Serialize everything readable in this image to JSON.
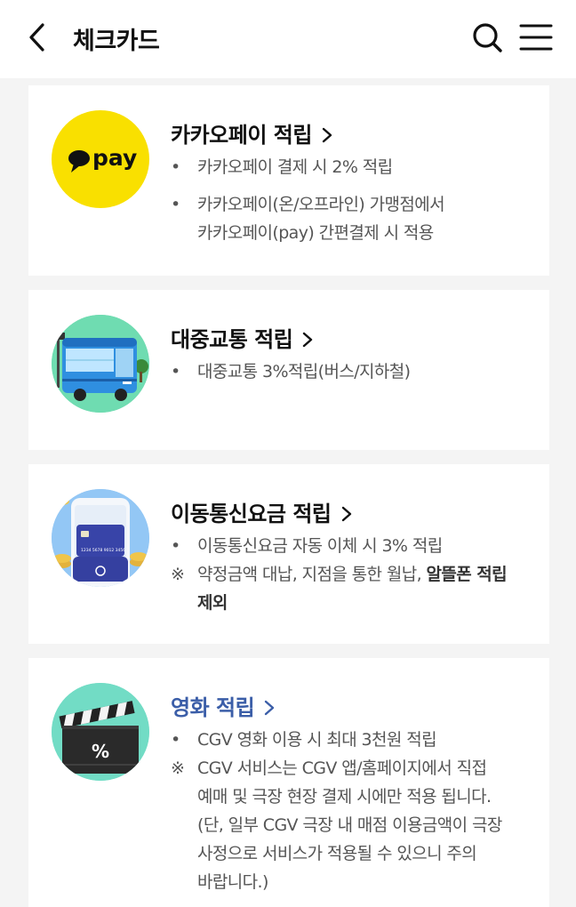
{
  "header": {
    "title": "체크카드"
  },
  "cards": [
    {
      "title": "카카오페이 적립",
      "logo_text": "pay",
      "line1": "카카오페이 결제 시 2% 적립",
      "line2": "카카오페이(온/오프라인) 가맹점에서",
      "line3": "카카오페이(pay) 간편결제 시 적용"
    },
    {
      "title": "대중교통 적립",
      "line1": "대중교통 3%적립(버스/지하철)"
    },
    {
      "title": "이동통신요금 적립",
      "card_number": "1234 5678 9012 3456",
      "line1": "이동통신요금 자동 이체 시 3% 적립",
      "line2_prefix": "약정금액 대납, 지점을 통한 월납,",
      "line2_bold": "알뜰폰 적립",
      "line3_bold": "제외"
    },
    {
      "title": "영화 적립",
      "line1": "CGV 영화 이용 시 최대 3천원 적립",
      "line2": "CGV 서비스는 CGV 앱/홈페이지에서 직접",
      "line3": "예매 및 극장 현장 결제 시에만 적용 됩니다.",
      "line4": "(단, 일부 CGV 극장 내 매점 이용금액이 극장",
      "line5": "사정으로 서비스가 적용될 수 있으니 주의",
      "line6": "바랍니다.)"
    }
  ],
  "symbols": {
    "bullet": "•",
    "note": "※",
    "percent": "%"
  },
  "colors": {
    "kakao_yellow": "#f9e000",
    "link_blue": "#3b5ea8",
    "background": "#f4f4f4"
  },
  "icons": [
    "back-icon",
    "search-icon",
    "menu-icon",
    "chevron-right-icon"
  ]
}
